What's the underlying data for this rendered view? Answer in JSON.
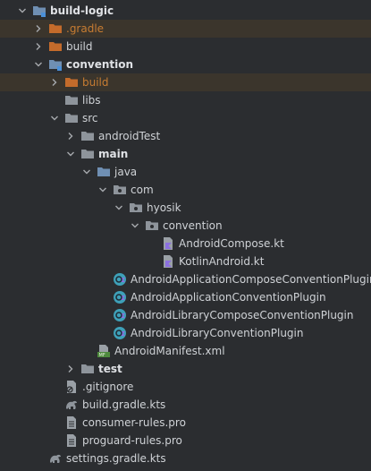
{
  "colors": {
    "background": "#2b2d30",
    "excluded_highlight": "#3b352c",
    "excluded_text": "#c77c32",
    "folder_blue": "#6f8fb3",
    "folder_gray": "#8e949b",
    "folder_orange": "#c46b2b",
    "kotlin_purple": "#8b6fe0",
    "plugin_teal": "#3ea0b8"
  },
  "tree": {
    "rows": [
      {
        "label": "build-logic",
        "depth": 0,
        "expander": "open",
        "icon": "module-folder-icon",
        "bold": true
      },
      {
        "label": ".gradle",
        "depth": 1,
        "expander": "closed",
        "icon": "excluded-folder-icon",
        "highlight": true,
        "style": "orange"
      },
      {
        "label": "build",
        "depth": 1,
        "expander": "closed",
        "icon": "excluded-folder-icon"
      },
      {
        "label": "convention",
        "depth": 1,
        "expander": "open",
        "icon": "module-folder-icon",
        "bold": true
      },
      {
        "label": "build",
        "depth": 2,
        "expander": "closed",
        "icon": "excluded-folder-icon",
        "highlight": true,
        "style": "orange"
      },
      {
        "label": "libs",
        "depth": 2,
        "expander": "none",
        "icon": "folder-icon"
      },
      {
        "label": "src",
        "depth": 2,
        "expander": "open",
        "icon": "folder-icon"
      },
      {
        "label": "androidTest",
        "depth": 3,
        "expander": "closed",
        "icon": "folder-icon"
      },
      {
        "label": "main",
        "depth": 3,
        "expander": "open",
        "icon": "folder-icon",
        "bold": true
      },
      {
        "label": "java",
        "depth": 4,
        "expander": "open",
        "icon": "source-folder-icon"
      },
      {
        "label": "com",
        "depth": 5,
        "expander": "open",
        "icon": "package-icon"
      },
      {
        "label": "hyosik",
        "depth": 6,
        "expander": "open",
        "icon": "package-icon"
      },
      {
        "label": "convention",
        "depth": 7,
        "expander": "open",
        "icon": "package-icon"
      },
      {
        "label": "AndroidCompose.kt",
        "depth": 8,
        "expander": "none",
        "icon": "kotlin-file-icon"
      },
      {
        "label": "KotlinAndroid.kt",
        "depth": 8,
        "expander": "none",
        "icon": "kotlin-file-icon"
      },
      {
        "label": "AndroidApplicationComposeConventionPlugin",
        "depth": 5,
        "expander": "none",
        "icon": "kotlin-class-icon"
      },
      {
        "label": "AndroidApplicationConventionPlugin",
        "depth": 5,
        "expander": "none",
        "icon": "kotlin-class-icon"
      },
      {
        "label": "AndroidLibraryComposeConventionPlugin",
        "depth": 5,
        "expander": "none",
        "icon": "kotlin-class-icon"
      },
      {
        "label": "AndroidLibraryConventionPlugin",
        "depth": 5,
        "expander": "none",
        "icon": "kotlin-class-icon"
      },
      {
        "label": "AndroidManifest.xml",
        "depth": 4,
        "expander": "none",
        "icon": "manifest-file-icon"
      },
      {
        "label": "test",
        "depth": 3,
        "expander": "closed",
        "icon": "folder-icon",
        "bold": true
      },
      {
        "label": ".gitignore",
        "depth": 2,
        "expander": "none",
        "icon": "gitignore-file-icon"
      },
      {
        "label": "build.gradle.kts",
        "depth": 2,
        "expander": "none",
        "icon": "gradle-file-icon"
      },
      {
        "label": "consumer-rules.pro",
        "depth": 2,
        "expander": "none",
        "icon": "text-file-icon"
      },
      {
        "label": "proguard-rules.pro",
        "depth": 2,
        "expander": "none",
        "icon": "text-file-icon"
      },
      {
        "label": "settings.gradle.kts",
        "depth": 1,
        "expander": "none",
        "icon": "gradle-file-icon"
      }
    ]
  }
}
